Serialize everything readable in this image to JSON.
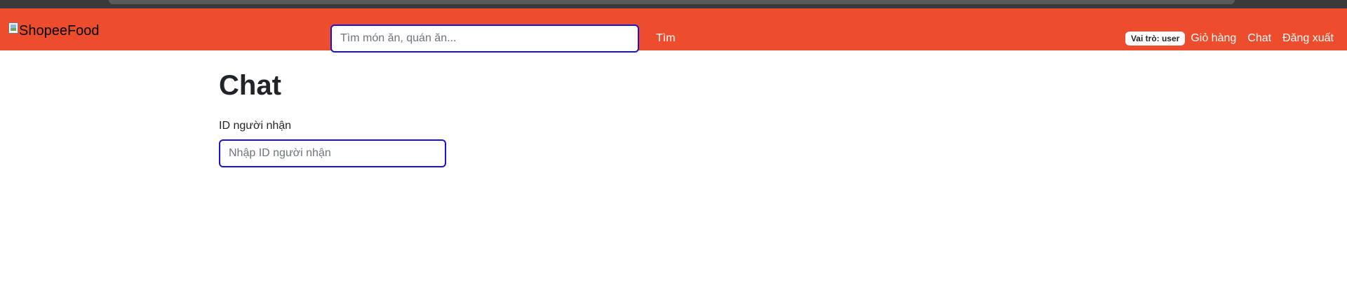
{
  "navbar": {
    "brand_alt": "ShopeeFood",
    "search": {
      "placeholder": "Tìm món ăn, quán ăn...",
      "value": "",
      "button_label": "Tìm"
    },
    "role_badge": "Vai trò: user",
    "links": {
      "cart": "Giỏ hàng",
      "chat": "Chat",
      "logout": "Đăng xuất"
    }
  },
  "main": {
    "title": "Chat",
    "recipient": {
      "label": "ID người nhận",
      "placeholder": "Nhập ID người nhận",
      "value": ""
    }
  },
  "colors": {
    "navbar_bg": "#ee4d2d",
    "focus_border": "#1a12d8",
    "text": "#212529"
  }
}
